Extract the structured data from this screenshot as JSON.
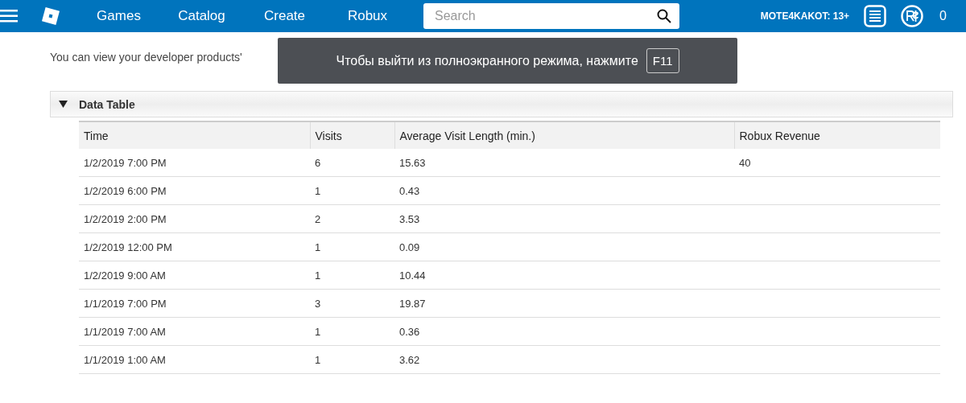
{
  "nav": {
    "links": [
      "Games",
      "Catalog",
      "Create",
      "Robux"
    ],
    "search": {
      "placeholder": "Search"
    },
    "user": "MOTE4KAKOT: 13+",
    "robux": "0"
  },
  "description": "You can view your developer products'",
  "fullscreen_notice": {
    "text": "Чтобы выйти из полноэкранного режима, нажмите",
    "key": "F11"
  },
  "section": {
    "title": "Data Table",
    "expanded": true
  },
  "table": {
    "columns": [
      "Time",
      "Visits",
      "Average Visit Length (min.)",
      "Robux Revenue"
    ],
    "rows": [
      [
        "1/2/2019 7:00 PM",
        "6",
        "15.63",
        "40"
      ],
      [
        "1/2/2019 6:00 PM",
        "1",
        "0.43",
        ""
      ],
      [
        "1/2/2019 2:00 PM",
        "2",
        "3.53",
        ""
      ],
      [
        "1/2/2019 12:00 PM",
        "1",
        "0.09",
        ""
      ],
      [
        "1/2/2019 9:00 AM",
        "1",
        "10.44",
        ""
      ],
      [
        "1/1/2019 7:00 PM",
        "3",
        "19.87",
        ""
      ],
      [
        "1/1/2019 7:00 AM",
        "1",
        "0.36",
        ""
      ],
      [
        "1/1/2019 1:00 AM",
        "1",
        "3.62",
        ""
      ]
    ]
  }
}
